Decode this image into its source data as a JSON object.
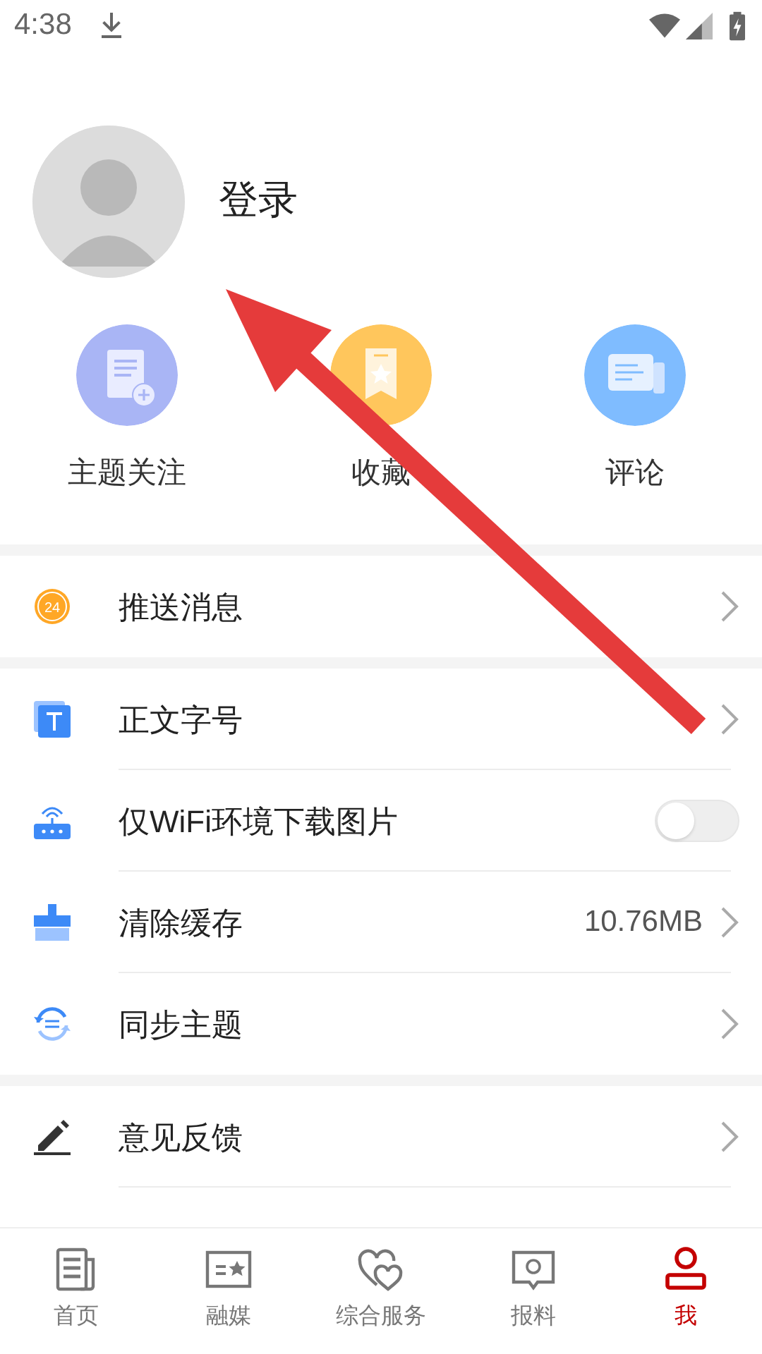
{
  "status_bar": {
    "time": "4:38"
  },
  "profile": {
    "login_label": "登录"
  },
  "shortcuts": [
    {
      "label": "主题关注",
      "color": "#a9b5f5"
    },
    {
      "label": "收藏",
      "color": "#ffc65c"
    },
    {
      "label": "评论",
      "color": "#7fbcff"
    }
  ],
  "sections": [
    [
      {
        "kind": "link",
        "label": "推送消息",
        "icon_text": "24"
      }
    ],
    [
      {
        "kind": "link",
        "label": "正文字号"
      },
      {
        "kind": "toggle",
        "label": "仅WiFi环境下载图片",
        "on": false
      },
      {
        "kind": "value",
        "label": "清除缓存",
        "value": "10.76MB"
      },
      {
        "kind": "link",
        "label": "同步主题"
      }
    ],
    [
      {
        "kind": "link",
        "label": "意见反馈"
      }
    ]
  ],
  "tabs": [
    {
      "label": "首页",
      "selected": false
    },
    {
      "label": "融媒",
      "selected": false
    },
    {
      "label": "综合服务",
      "selected": false
    },
    {
      "label": "报料",
      "selected": false
    },
    {
      "label": "我",
      "selected": true
    }
  ]
}
